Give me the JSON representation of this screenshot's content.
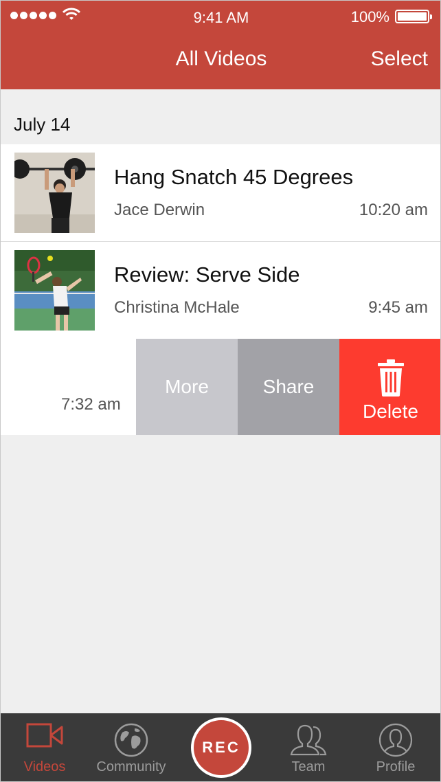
{
  "status_bar": {
    "time": "9:41 AM",
    "battery": "100%"
  },
  "nav": {
    "title": "All Videos",
    "select_label": "Select"
  },
  "section": {
    "date": "July 14"
  },
  "videos": [
    {
      "title": "Hang Snatch 45 Degrees",
      "author": "Jace Derwin",
      "time": "10:20 am",
      "thumb": "weightlifter-thumbnail"
    },
    {
      "title": "Review: Serve Side",
      "author": "Christina McHale",
      "time": "9:45 am",
      "thumb": "tennis-serve-thumbnail"
    }
  ],
  "swipe_row": {
    "time": "7:32 am",
    "actions": {
      "more": "More",
      "share": "Share",
      "delete": "Delete"
    }
  },
  "tabbar": {
    "videos": "Videos",
    "community": "Community",
    "rec": "REC",
    "team": "Team",
    "profile": "Profile"
  },
  "colors": {
    "brand": "#c4473b",
    "delete": "#fd3b2f",
    "more": "#c7c7cc",
    "share": "#a2a2a7",
    "tabbar": "#3a3a3a"
  }
}
